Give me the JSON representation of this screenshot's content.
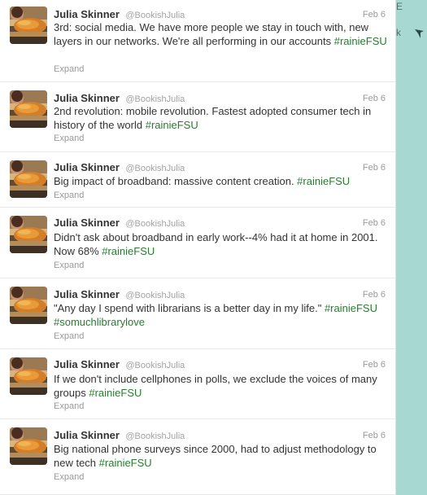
{
  "colors": {
    "background": "#a7d8d2",
    "hashtag": "#2a7b32",
    "meta_gray": "#999999",
    "text": "#333333"
  },
  "side_marks": {
    "top_char": "Ε",
    "mid_char": "k",
    "pointer_icon": "arrow-pointer-icon"
  },
  "tweets": [
    {
      "name": "Julia Skinner",
      "handle": "@BookishJulia",
      "date": "Feb 6",
      "segments": [
        {
          "text": "3rd: social media. We have more people we stay in touch with, new layers in our networks. We're all performing in our accounts ",
          "type": "text"
        },
        {
          "text": "#rainieFSU",
          "type": "hashtag"
        }
      ],
      "expand": "Expand"
    },
    {
      "name": "Julia Skinner",
      "handle": "@BookishJulia",
      "date": "Feb 6",
      "segments": [
        {
          "text": "2nd revolution: mobile revolution. Fastest adopted consumer tech in history of the world ",
          "type": "text"
        },
        {
          "text": "#rainieFSU",
          "type": "hashtag"
        }
      ],
      "expand": "Expand"
    },
    {
      "name": "Julia Skinner",
      "handle": "@BookishJulia",
      "date": "Feb 6",
      "segments": [
        {
          "text": "Big impact of broadband: massive content creation. ",
          "type": "text"
        },
        {
          "text": "#rainieFSU",
          "type": "hashtag"
        }
      ],
      "expand": "Expand"
    },
    {
      "name": "Julia Skinner",
      "handle": "@BookishJulia",
      "date": "Feb 6",
      "segments": [
        {
          "text": "Didn't ask about broadband in early work--4% had it at home in 2001. Now 68% ",
          "type": "text"
        },
        {
          "text": "#rainieFSU",
          "type": "hashtag"
        }
      ],
      "expand": "Expand"
    },
    {
      "name": "Julia Skinner",
      "handle": "@BookishJulia",
      "date": "Feb 6",
      "segments": [
        {
          "text": "\"Any day I spend with librarians is a better day in my life.\" ",
          "type": "text"
        },
        {
          "text": "#rainieFSU",
          "type": "hashtag"
        },
        {
          "text": " ",
          "type": "text"
        },
        {
          "text": "#somuchlibrarylove",
          "type": "hashtag"
        }
      ],
      "expand": "Expand"
    },
    {
      "name": "Julia Skinner",
      "handle": "@BookishJulia",
      "date": "Feb 6",
      "segments": [
        {
          "text": "If we don't include cellphones in polls, we exclude the voices of many groups ",
          "type": "text"
        },
        {
          "text": "#rainieFSU",
          "type": "hashtag"
        }
      ],
      "expand": "Expand"
    },
    {
      "name": "Julia Skinner",
      "handle": "@BookishJulia",
      "date": "Feb 6",
      "segments": [
        {
          "text": "Big national phone surveys since 2000, had to adjust methodology to new tech ",
          "type": "text"
        },
        {
          "text": "#rainieFSU",
          "type": "hashtag"
        }
      ],
      "expand": "Expand"
    }
  ]
}
